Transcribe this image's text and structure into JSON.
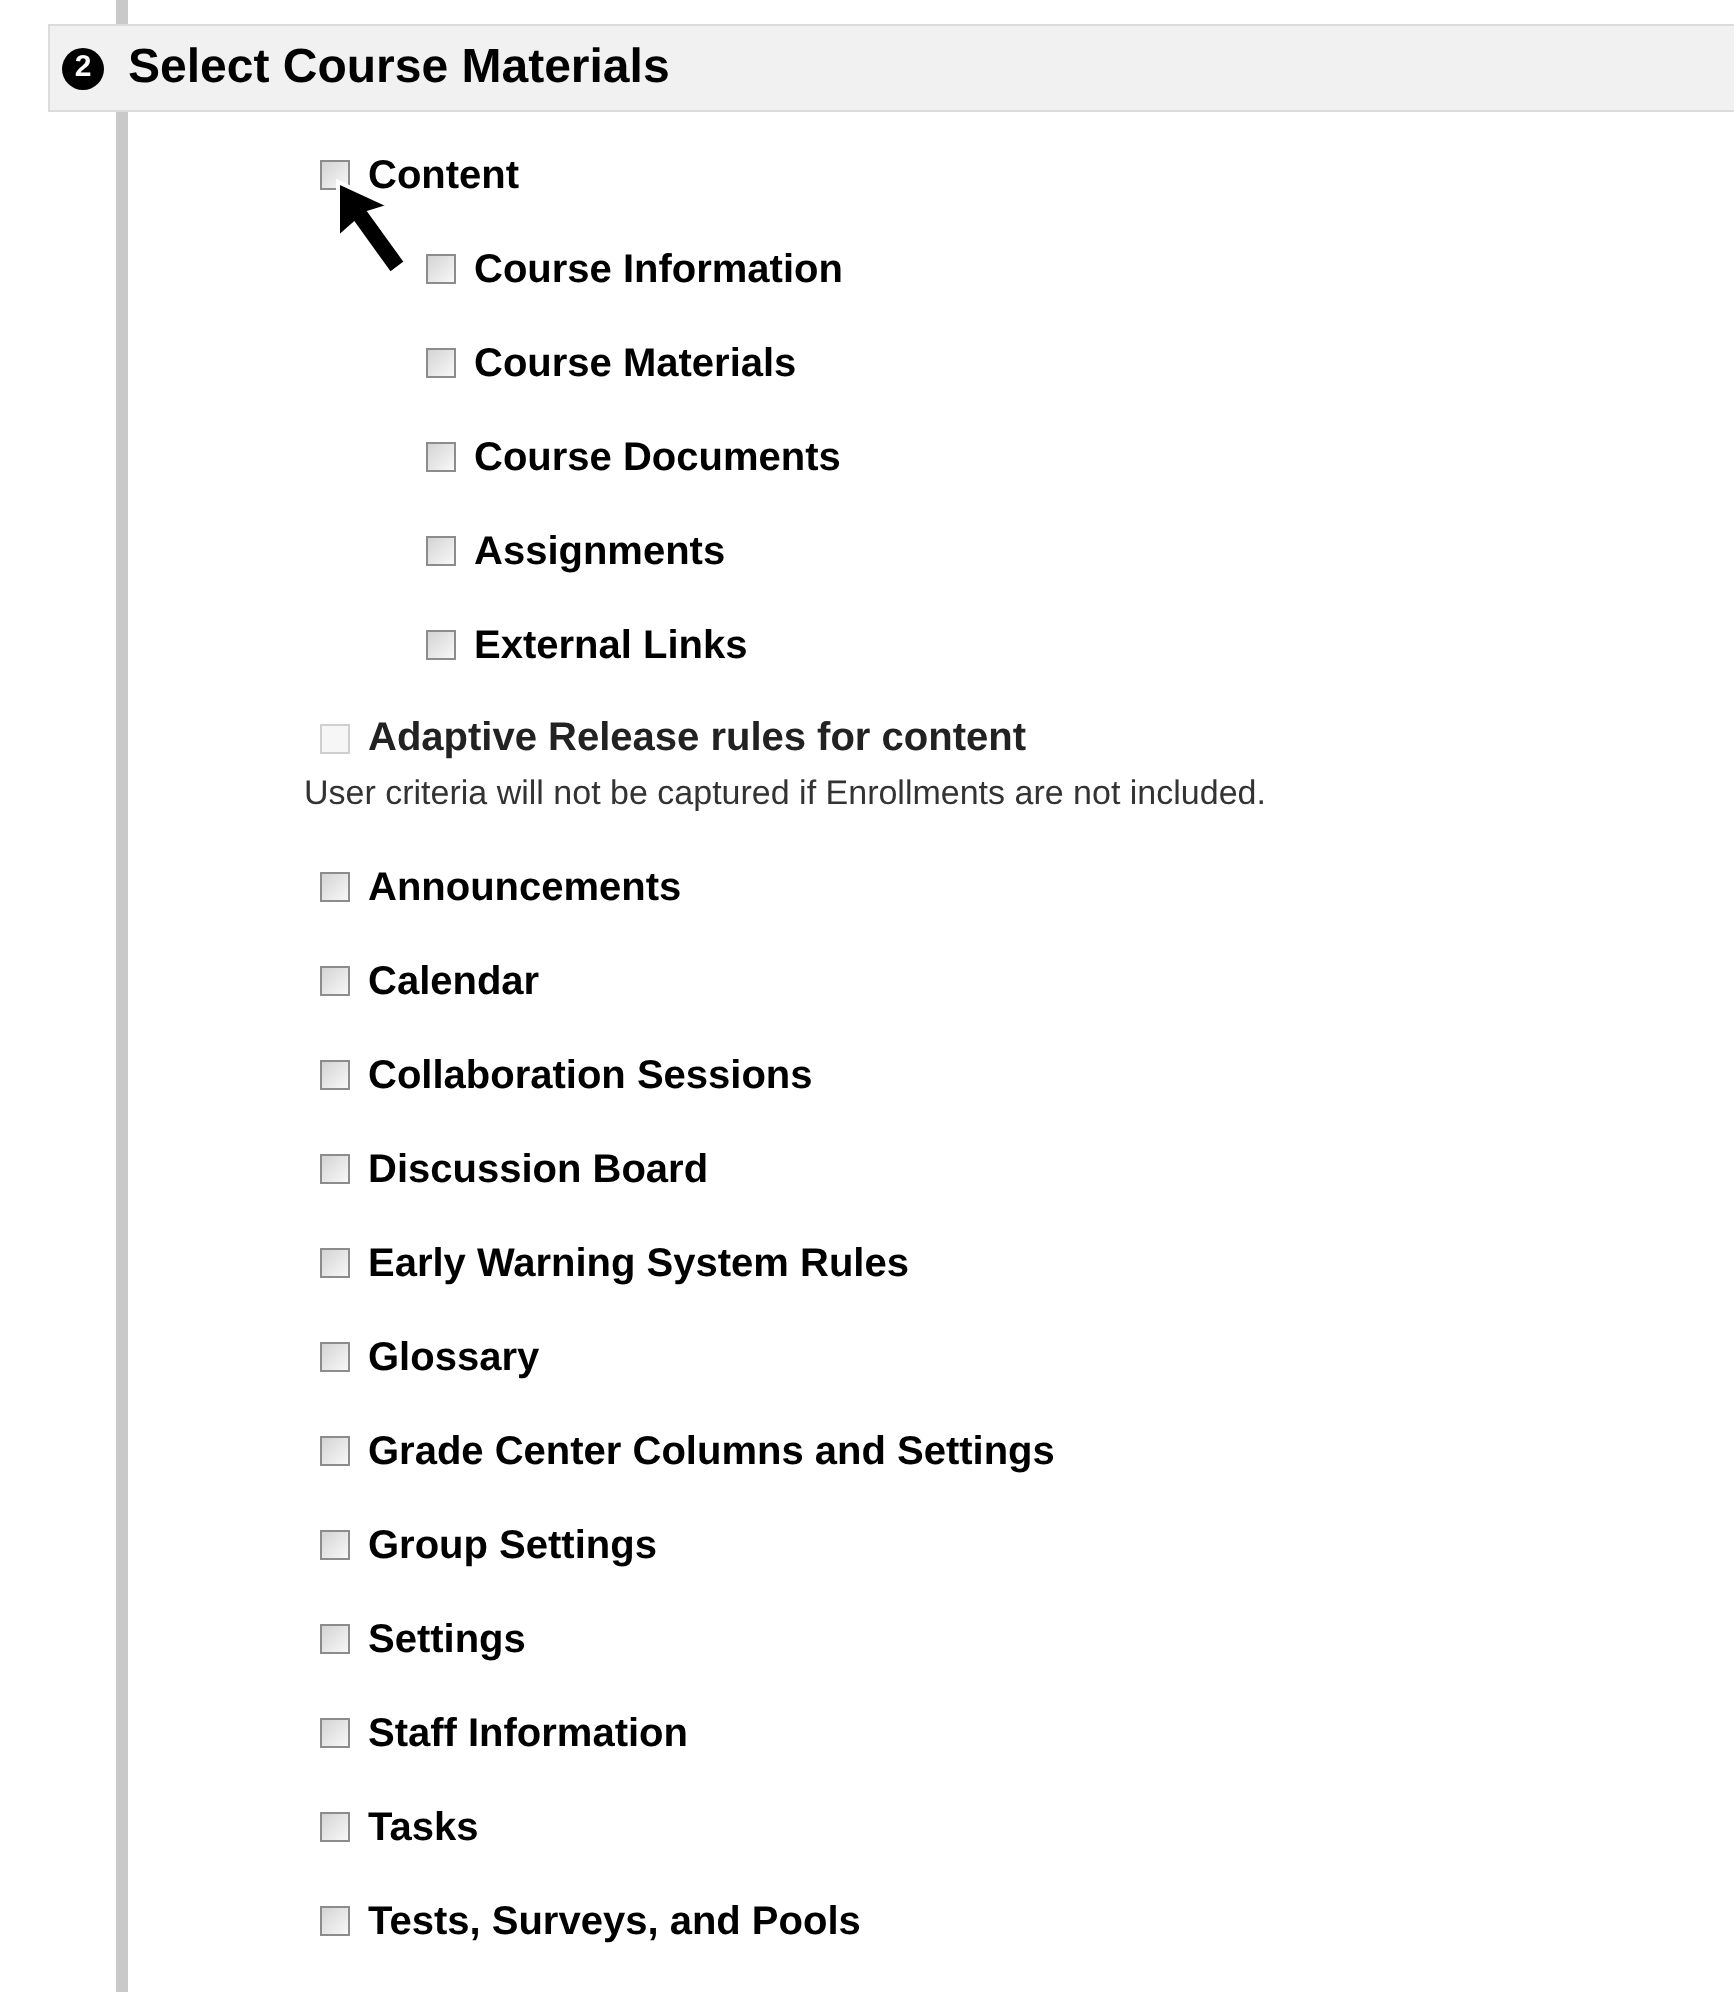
{
  "section": {
    "step": "2",
    "title": "Select Course Materials"
  },
  "items": [
    {
      "label": "Content",
      "checked": false,
      "disabled": false,
      "children": [
        {
          "label": "Course Information",
          "checked": false,
          "disabled": false
        },
        {
          "label": "Course Materials",
          "checked": false,
          "disabled": false
        },
        {
          "label": "Course Documents",
          "checked": false,
          "disabled": false
        },
        {
          "label": "Assignments",
          "checked": false,
          "disabled": false
        },
        {
          "label": "External Links",
          "checked": false,
          "disabled": false
        }
      ]
    },
    {
      "label": "Adaptive Release rules for content",
      "checked": false,
      "disabled": true,
      "note": "User criteria will not be captured if Enrollments are not included."
    },
    {
      "label": "Announcements",
      "checked": false,
      "disabled": false
    },
    {
      "label": "Calendar",
      "checked": false,
      "disabled": false
    },
    {
      "label": "Collaboration Sessions",
      "checked": false,
      "disabled": false
    },
    {
      "label": "Discussion Board",
      "checked": false,
      "disabled": false
    },
    {
      "label": "Early Warning System Rules",
      "checked": false,
      "disabled": false
    },
    {
      "label": "Glossary",
      "checked": false,
      "disabled": false
    },
    {
      "label": "Grade Center Columns and Settings",
      "checked": false,
      "disabled": false
    },
    {
      "label": "Group Settings",
      "checked": false,
      "disabled": false
    },
    {
      "label": "Settings",
      "checked": false,
      "disabled": false
    },
    {
      "label": "Staff Information",
      "checked": false,
      "disabled": false
    },
    {
      "label": "Tasks",
      "checked": false,
      "disabled": false
    },
    {
      "label": "Tests, Surveys, and Pools",
      "checked": false,
      "disabled": false
    }
  ]
}
